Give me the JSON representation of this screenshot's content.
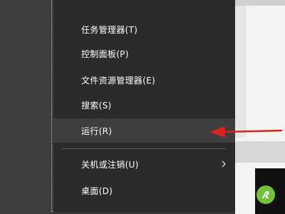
{
  "menu": {
    "items": [
      {
        "label": "任务管理器(T)"
      },
      {
        "label": "控制面板(P)"
      },
      {
        "label": "文件资源管理器(E)"
      },
      {
        "label": "搜索(S)"
      },
      {
        "label": "运行(R)"
      },
      {
        "label": "关机或注销(U)"
      },
      {
        "label": "桌面(D)"
      }
    ],
    "highlighted_item": "运行(R)"
  },
  "annotation": {
    "icon": "arrow-left-icon",
    "color": "#d9221c"
  },
  "taskbar_app_icon": {
    "icon": "green-app-icon",
    "color": "#73c23a"
  }
}
